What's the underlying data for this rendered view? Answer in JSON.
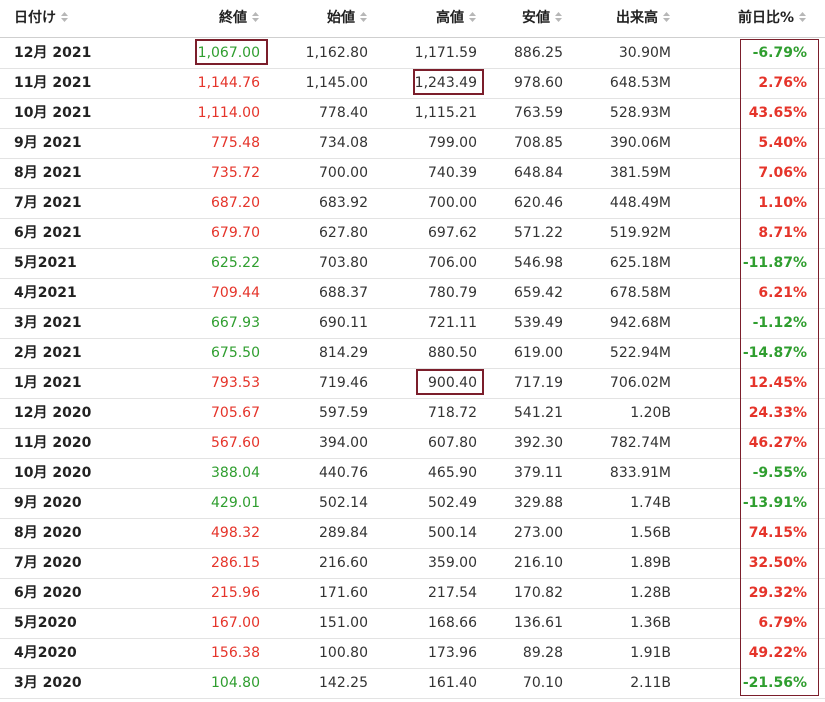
{
  "headers": {
    "date": "日付け",
    "close": "終値",
    "open": "始値",
    "high": "高値",
    "low": "安値",
    "volume": "出来高",
    "change": "前日比%"
  },
  "colors": {
    "up": "#e5342a",
    "down": "#2f9e2f",
    "highlight_border": "#7b1e2b"
  },
  "rows": [
    {
      "date": "12月 2021",
      "close": "1,067.00",
      "open": "1,162.80",
      "high": "1,171.59",
      "low": "886.25",
      "volume": "30.90M",
      "change": "-6.79%",
      "dir": "down"
    },
    {
      "date": "11月 2021",
      "close": "1,144.76",
      "open": "1,145.00",
      "high": "1,243.49",
      "low": "978.60",
      "volume": "648.53M",
      "change": "2.76%",
      "dir": "up"
    },
    {
      "date": "10月 2021",
      "close": "1,114.00",
      "open": "778.40",
      "high": "1,115.21",
      "low": "763.59",
      "volume": "528.93M",
      "change": "43.65%",
      "dir": "up"
    },
    {
      "date": "9月 2021",
      "close": "775.48",
      "open": "734.08",
      "high": "799.00",
      "low": "708.85",
      "volume": "390.06M",
      "change": "5.40%",
      "dir": "up"
    },
    {
      "date": "8月 2021",
      "close": "735.72",
      "open": "700.00",
      "high": "740.39",
      "low": "648.84",
      "volume": "381.59M",
      "change": "7.06%",
      "dir": "up"
    },
    {
      "date": "7月 2021",
      "close": "687.20",
      "open": "683.92",
      "high": "700.00",
      "low": "620.46",
      "volume": "448.49M",
      "change": "1.10%",
      "dir": "up"
    },
    {
      "date": "6月 2021",
      "close": "679.70",
      "open": "627.80",
      "high": "697.62",
      "low": "571.22",
      "volume": "519.92M",
      "change": "8.71%",
      "dir": "up"
    },
    {
      "date": "5月2021",
      "close": "625.22",
      "open": "703.80",
      "high": "706.00",
      "low": "546.98",
      "volume": "625.18M",
      "change": "-11.87%",
      "dir": "down"
    },
    {
      "date": "4月2021",
      "close": "709.44",
      "open": "688.37",
      "high": "780.79",
      "low": "659.42",
      "volume": "678.58M",
      "change": "6.21%",
      "dir": "up"
    },
    {
      "date": "3月 2021",
      "close": "667.93",
      "open": "690.11",
      "high": "721.11",
      "low": "539.49",
      "volume": "942.68M",
      "change": "-1.12%",
      "dir": "down"
    },
    {
      "date": "2月 2021",
      "close": "675.50",
      "open": "814.29",
      "high": "880.50",
      "low": "619.00",
      "volume": "522.94M",
      "change": "-14.87%",
      "dir": "down"
    },
    {
      "date": "1月 2021",
      "close": "793.53",
      "open": "719.46",
      "high": "900.40",
      "low": "717.19",
      "volume": "706.02M",
      "change": "12.45%",
      "dir": "up"
    },
    {
      "date": "12月 2020",
      "close": "705.67",
      "open": "597.59",
      "high": "718.72",
      "low": "541.21",
      "volume": "1.20B",
      "change": "24.33%",
      "dir": "up"
    },
    {
      "date": "11月 2020",
      "close": "567.60",
      "open": "394.00",
      "high": "607.80",
      "low": "392.30",
      "volume": "782.74M",
      "change": "46.27%",
      "dir": "up"
    },
    {
      "date": "10月 2020",
      "close": "388.04",
      "open": "440.76",
      "high": "465.90",
      "low": "379.11",
      "volume": "833.91M",
      "change": "-9.55%",
      "dir": "down"
    },
    {
      "date": "9月 2020",
      "close": "429.01",
      "open": "502.14",
      "high": "502.49",
      "low": "329.88",
      "volume": "1.74B",
      "change": "-13.91%",
      "dir": "down"
    },
    {
      "date": "8月 2020",
      "close": "498.32",
      "open": "289.84",
      "high": "500.14",
      "low": "273.00",
      "volume": "1.56B",
      "change": "74.15%",
      "dir": "up"
    },
    {
      "date": "7月 2020",
      "close": "286.15",
      "open": "216.60",
      "high": "359.00",
      "low": "216.10",
      "volume": "1.89B",
      "change": "32.50%",
      "dir": "up"
    },
    {
      "date": "6月 2020",
      "close": "215.96",
      "open": "171.60",
      "high": "217.54",
      "low": "170.82",
      "volume": "1.28B",
      "change": "29.32%",
      "dir": "up"
    },
    {
      "date": "5月2020",
      "close": "167.00",
      "open": "151.00",
      "high": "168.66",
      "low": "136.61",
      "volume": "1.36B",
      "change": "6.79%",
      "dir": "up"
    },
    {
      "date": "4月2020",
      "close": "156.38",
      "open": "100.80",
      "high": "173.96",
      "low": "89.28",
      "volume": "1.91B",
      "change": "49.22%",
      "dir": "up"
    },
    {
      "date": "3月 2020",
      "close": "104.80",
      "open": "142.25",
      "high": "161.40",
      "low": "70.10",
      "volume": "2.11B",
      "change": "-21.56%",
      "dir": "down"
    }
  ]
}
